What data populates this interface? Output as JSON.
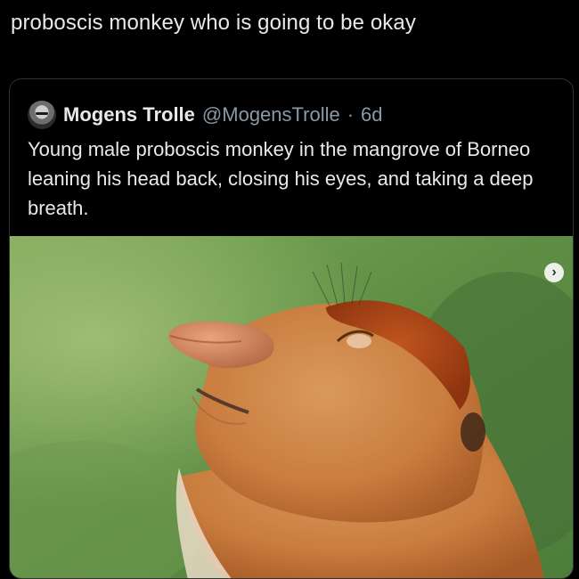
{
  "caption": "proboscis monkey who is going to be okay",
  "tweet": {
    "display_name": "Mogens Trolle",
    "handle": "@MogensTrolle",
    "separator": "·",
    "age": "6d",
    "text": "Young male proboscis monkey in the mangrove of Borneo leaning his head back, closing his eyes, and taking a deep breath."
  },
  "media": {
    "next_icon": "chevron-right-icon",
    "next_glyph": "›"
  },
  "colors": {
    "background": "#000000",
    "text": "#e7e9ea",
    "secondary_text": "#8b98a5",
    "border": "#2f3336"
  }
}
